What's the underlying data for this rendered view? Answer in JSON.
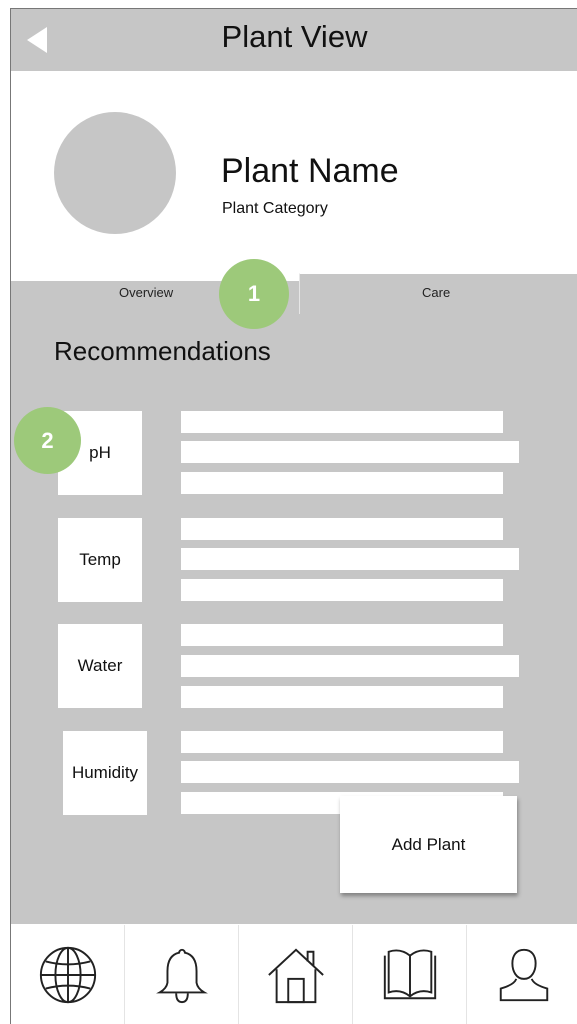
{
  "header": {
    "title": "Plant View"
  },
  "plant": {
    "name": "Plant Name",
    "category": "Plant Category"
  },
  "tabs": [
    {
      "label": "Overview"
    },
    {
      "label": "Care"
    }
  ],
  "badges": [
    "1",
    "2"
  ],
  "recommendations": {
    "heading": "Recommendations",
    "items": [
      {
        "label": "pH"
      },
      {
        "label": "Temp"
      },
      {
        "label": "Water"
      },
      {
        "label": "Humidity"
      }
    ]
  },
  "actions": {
    "add_plant": "Add Plant"
  },
  "bottom_nav": [
    {
      "icon": "globe-icon"
    },
    {
      "icon": "bell-icon"
    },
    {
      "icon": "home-icon"
    },
    {
      "icon": "book-icon"
    },
    {
      "icon": "user-icon"
    }
  ],
  "colors": {
    "panel": "#c6c6c6",
    "badge": "#9dc97a",
    "background": "#ffffff",
    "text": "#111111"
  }
}
